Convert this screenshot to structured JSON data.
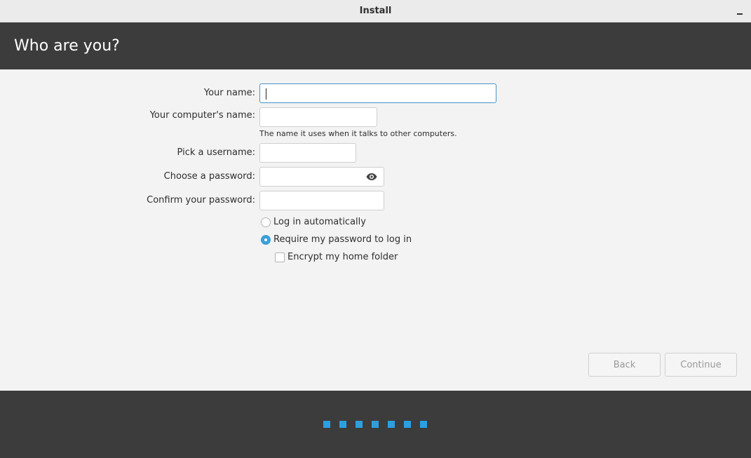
{
  "window": {
    "title": "Install"
  },
  "header": {
    "title": "Who are you?"
  },
  "form": {
    "name_label": "Your name:",
    "name_value": "",
    "computer_label": "Your computer's name:",
    "computer_value": "",
    "computer_hint": "The name it uses when it talks to other computers.",
    "username_label": "Pick a username:",
    "username_value": "",
    "password_label": "Choose a password:",
    "password_value": "",
    "confirm_label": "Confirm your password:",
    "confirm_value": ""
  },
  "options": {
    "auto_login_label": "Log in automatically",
    "auto_login_selected": false,
    "require_password_label": "Require my password to log in",
    "require_password_selected": true,
    "encrypt_home_label": "Encrypt my home folder",
    "encrypt_home_checked": false
  },
  "buttons": {
    "back_label": "Back",
    "continue_label": "Continue"
  },
  "progress": {
    "steps": 7,
    "color": "#2d9fe0"
  },
  "colors": {
    "header_bg": "#3c3c3c",
    "accent": "#3c9fd8",
    "focus_border": "#4a93c5"
  }
}
